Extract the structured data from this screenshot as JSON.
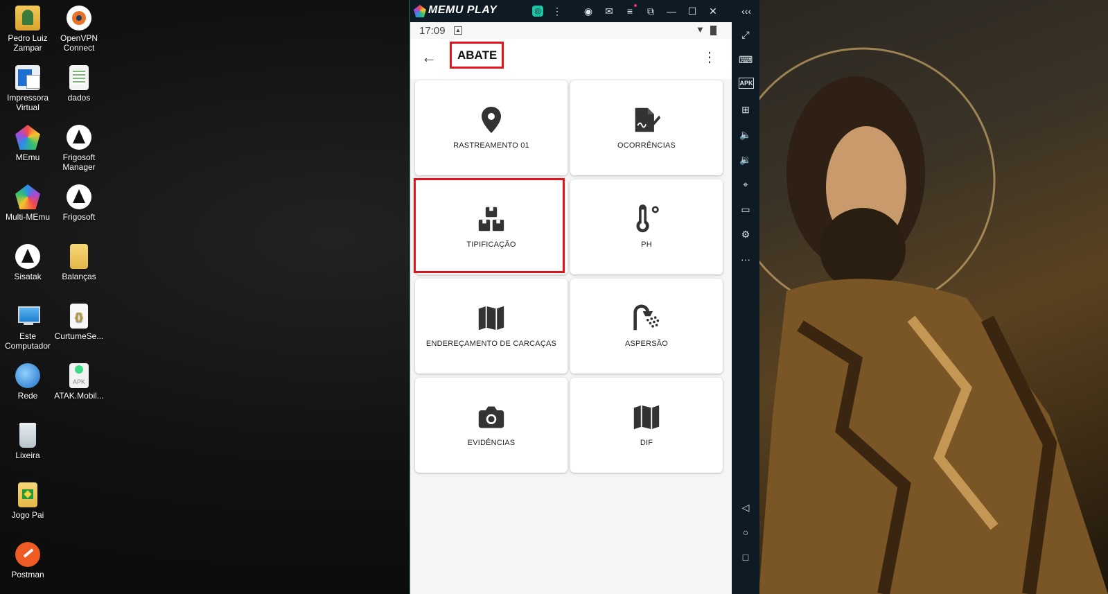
{
  "desktop": {
    "icons": [
      {
        "label": "Pedro Luiz Zampar"
      },
      {
        "label": "OpenVPN Connect"
      },
      {
        "label": "Impressora Virtual"
      },
      {
        "label": "dados"
      },
      {
        "label": "MEmu"
      },
      {
        "label": "Frigosoft Manager"
      },
      {
        "label": "Multi-MEmu"
      },
      {
        "label": "Frigosoft"
      },
      {
        "label": "Sisatak"
      },
      {
        "label": "Balanças"
      },
      {
        "label": "Este Computador"
      },
      {
        "label": "CurtumeSe..."
      },
      {
        "label": "Rede"
      },
      {
        "label": "ATAK.Mobil..."
      },
      {
        "label": "Lixeira"
      },
      {
        "label": "Jogo Pai"
      },
      {
        "label": "Postman"
      }
    ],
    "apk_badge": "APK"
  },
  "emulator": {
    "title": "MEMU PLAY",
    "status": {
      "time": "17:09"
    },
    "app": {
      "title": "ABATE",
      "tiles": [
        {
          "label": "RASTREAMENTO 01",
          "icon": "location-pin-icon"
        },
        {
          "label": "OCORRÊNCIAS",
          "icon": "signed-document-icon"
        },
        {
          "label": "TIPIFICAÇÃO",
          "icon": "boxes-icon"
        },
        {
          "label": "PH",
          "icon": "thermometer-icon"
        },
        {
          "label": "ENDEREÇAMENTO DE CARCAÇAS",
          "icon": "map-icon"
        },
        {
          "label": "ASPERSÃO",
          "icon": "shower-icon"
        },
        {
          "label": "EVIDÊNCIAS",
          "icon": "camera-icon"
        },
        {
          "label": "DIF",
          "icon": "map-icon"
        }
      ]
    },
    "sidebar_apk": "APK"
  },
  "colors": {
    "highlight": "#e0141a",
    "emulator_bg": "#0f1b24",
    "icon_dark": "#333333"
  }
}
